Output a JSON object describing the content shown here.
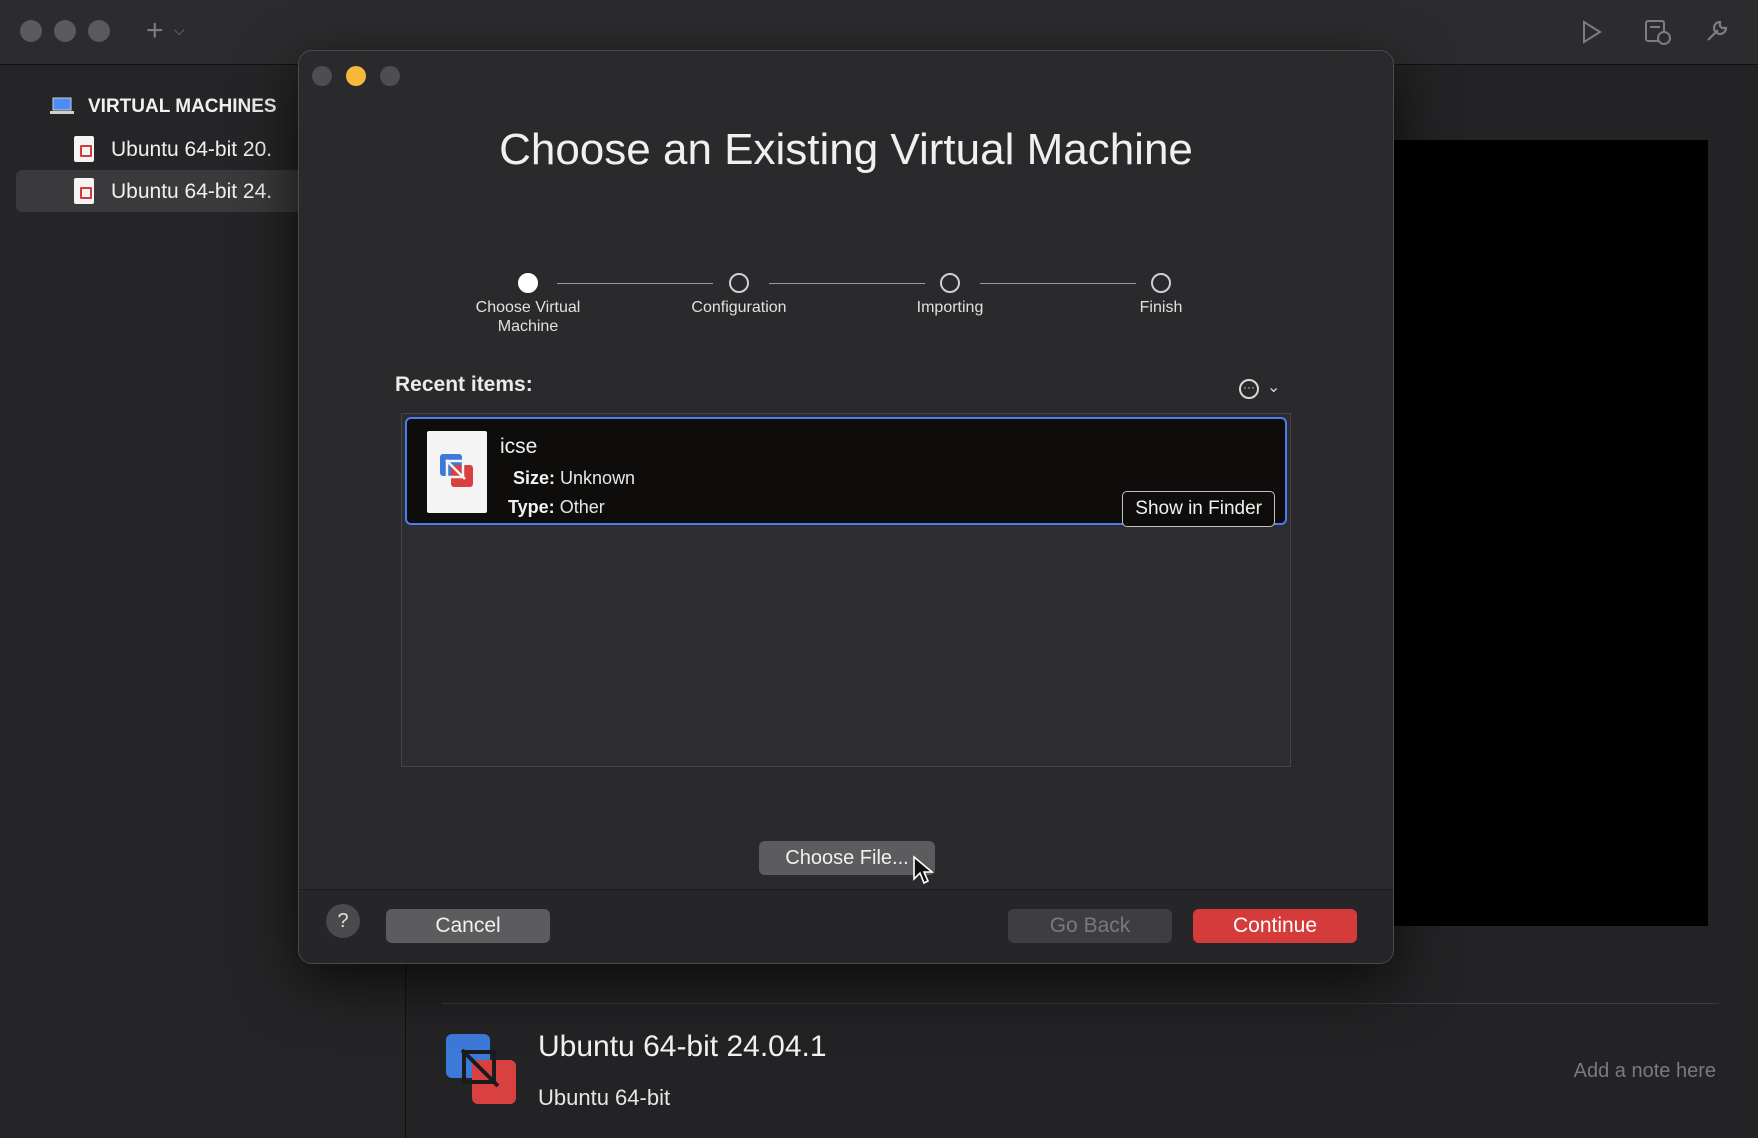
{
  "window": {
    "sidebar": {
      "header": "VIRTUAL MACHINES",
      "items": [
        {
          "label": "Ubuntu 64-bit 20."
        },
        {
          "label": "Ubuntu 64-bit 24."
        }
      ]
    },
    "detail": {
      "vm_title": "Ubuntu 64-bit 24.04.1",
      "vm_subtitle": "Ubuntu 64-bit",
      "note_placeholder": "Add a note here"
    },
    "toolbar": {
      "add_icon": "plus-icon",
      "play_icon": "play-icon",
      "snapshot_icon": "snapshot-icon",
      "settings_icon": "wrench-icon"
    }
  },
  "dialog": {
    "title": "Choose an Existing Virtual Machine",
    "steps": [
      {
        "label": "Choose Virtual Machine",
        "active": true
      },
      {
        "label": "Configuration",
        "active": false
      },
      {
        "label": "Importing",
        "active": false
      },
      {
        "label": "Finish",
        "active": false
      }
    ],
    "recent_label": "Recent items:",
    "recent_items": [
      {
        "name": "icse",
        "size_key": "Size:",
        "size_value": "Unknown",
        "type_key": "Type:",
        "type_value": "Other",
        "show_in_finder": "Show in Finder"
      }
    ],
    "choose_file": "Choose File...",
    "help": "?",
    "cancel": "Cancel",
    "go_back": "Go Back",
    "continue": "Continue"
  },
  "colors": {
    "accent": "#d63b3b",
    "selection_border": "#4a7cf5",
    "traffic_yellow": "#f5b83a"
  }
}
